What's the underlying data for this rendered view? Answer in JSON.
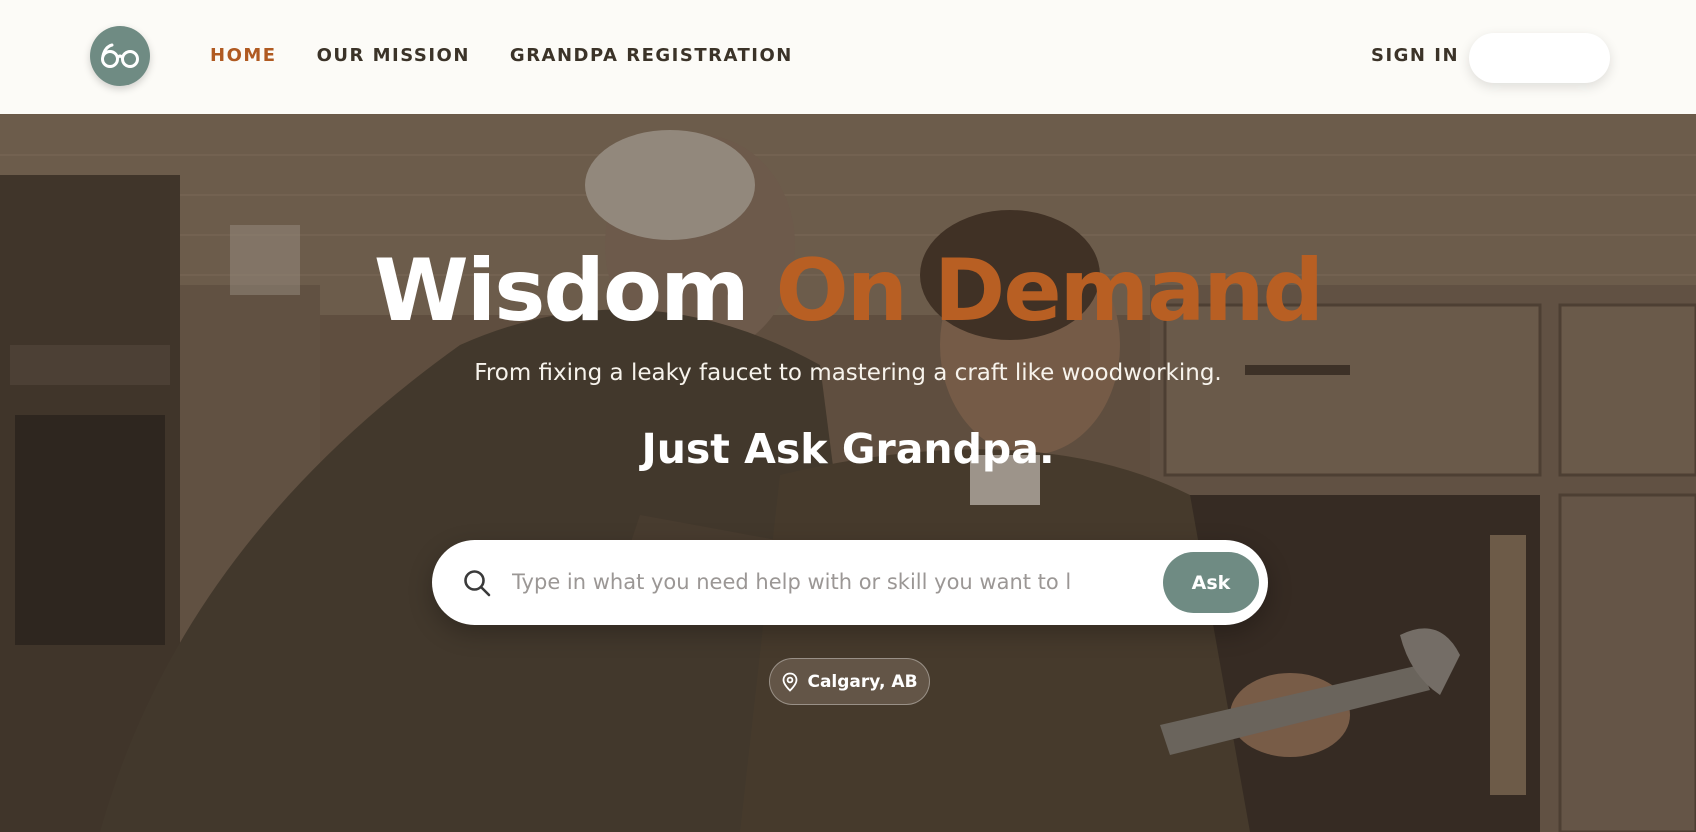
{
  "header": {
    "logo_icon": "reading-glasses-icon",
    "nav": [
      {
        "label": "HOME",
        "active": true
      },
      {
        "label": "OUR MISSION",
        "active": false
      },
      {
        "label": "GRANDPA REGISTRATION",
        "active": false
      }
    ],
    "sign_in_label": "SIGN IN"
  },
  "hero": {
    "title_main": "Wisdom",
    "title_accent": "On Demand",
    "subtitle": "From fixing a leaky faucet to mastering a craft like woodworking.",
    "tagline": "Just Ask Grandpa.",
    "search": {
      "placeholder": "Type in what you need help with or skill you want to learn",
      "value": "",
      "button_label": "Ask"
    },
    "location": {
      "label": "Calgary, AB",
      "icon": "map-pin-icon"
    }
  },
  "colors": {
    "accent": "#b85f23",
    "nav_active": "#b05a21",
    "primary": "#6f8b83",
    "header_bg": "#fcfbf7"
  }
}
